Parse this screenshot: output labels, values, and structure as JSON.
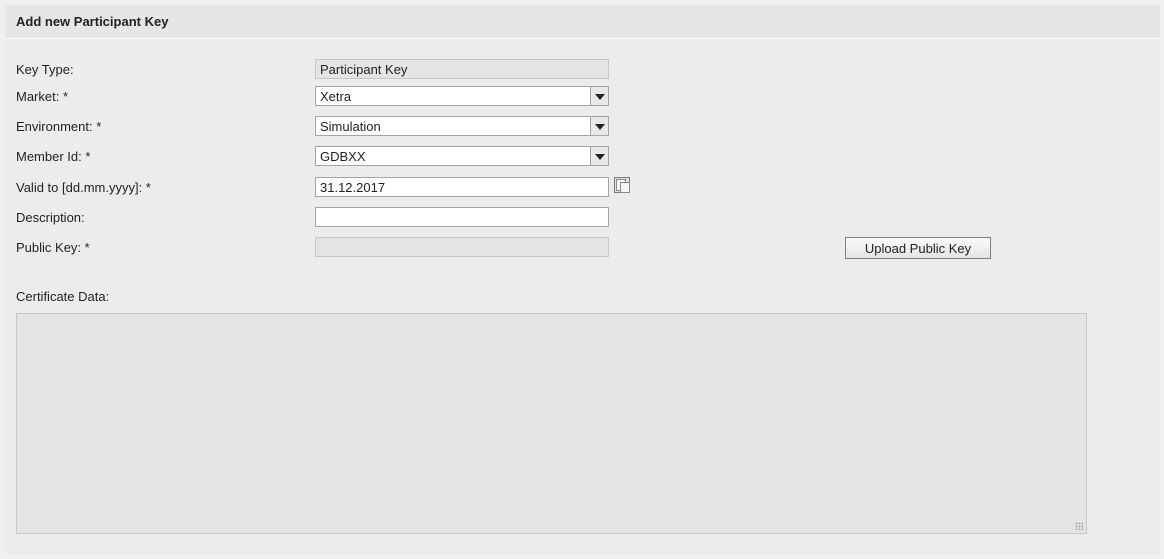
{
  "title": "Add new Participant Key",
  "form": {
    "key_type": {
      "label": "Key Type:",
      "value": "Participant Key"
    },
    "market": {
      "label": "Market: *",
      "value": "Xetra"
    },
    "environment": {
      "label": "Environment: *",
      "value": "Simulation"
    },
    "member_id": {
      "label": "Member Id: *",
      "value": "GDBXX"
    },
    "valid_to": {
      "label": "Valid to [dd.mm.yyyy]: *",
      "value": "31.12.2017"
    },
    "description": {
      "label": "Description:",
      "value": ""
    },
    "public_key": {
      "label": "Public Key: *",
      "value": ""
    },
    "upload_button": "Upload Public Key",
    "certificate_data": {
      "label": "Certificate Data:",
      "value": ""
    }
  },
  "icons": {
    "calendar": "calendar-icon",
    "dropdown": "chevron-down-icon",
    "resize": "resize-grip-icon"
  },
  "colors": {
    "background": "#ececec",
    "header": "#e6e6e6",
    "readonly_field": "#e4e4e4"
  }
}
